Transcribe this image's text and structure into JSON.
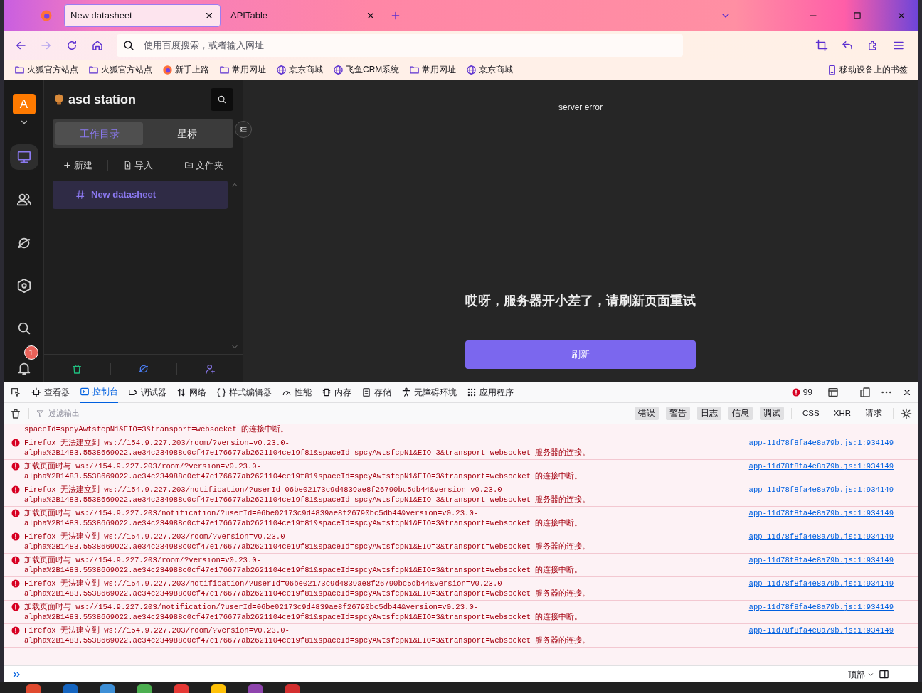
{
  "browser": {
    "tabs": [
      {
        "label": "New datasheet",
        "selected": true
      },
      {
        "label": "APITable",
        "selected": false
      }
    ],
    "address_placeholder": "使用百度搜索，或者输入网址",
    "bookmarks": [
      {
        "label": "火狐官方站点",
        "kind": "folder"
      },
      {
        "label": "火狐官方站点",
        "kind": "folder"
      },
      {
        "label": "新手上路",
        "kind": "firefox"
      },
      {
        "label": "常用网址",
        "kind": "folder"
      },
      {
        "label": "京东商城",
        "kind": "globe"
      },
      {
        "label": "飞鱼CRM系统",
        "kind": "globe"
      },
      {
        "label": "常用网址",
        "kind": "folder"
      },
      {
        "label": "京东商城",
        "kind": "globe"
      }
    ],
    "mobile_bookmarks": "移动设备上的书签"
  },
  "app": {
    "avatar": "A",
    "nav": [
      {
        "kind": "monitor",
        "selected": true
      },
      {
        "kind": "users",
        "selected": false
      },
      {
        "kind": "planet",
        "selected": false
      },
      {
        "kind": "settings",
        "selected": false
      },
      {
        "kind": "search",
        "selected": false
      },
      {
        "kind": "bell",
        "selected": false
      }
    ],
    "notification_count": "1",
    "space_name": "asd station",
    "sidebar_tabs": [
      {
        "label": "工作目录",
        "selected": true
      },
      {
        "label": "星标",
        "selected": false
      }
    ],
    "actions": [
      {
        "label": "新建",
        "kind": "plus"
      },
      {
        "label": "导入",
        "kind": "file"
      },
      {
        "label": "文件夹",
        "kind": "folderplus"
      }
    ],
    "tree": [
      {
        "label": "New datasheet",
        "selected": true
      }
    ],
    "footer": [
      {
        "kind": "trash"
      },
      {
        "kind": "planet"
      },
      {
        "kind": "personplus"
      }
    ],
    "status": "server error",
    "message": "哎呀，服务器开小差了，请刷新页面重试",
    "button": "刷新"
  },
  "devtools": {
    "tabs": [
      {
        "label": "查看器",
        "kind": "inspector",
        "selected": false
      },
      {
        "label": "控制台",
        "kind": "console",
        "selected": true
      },
      {
        "label": "调试器",
        "kind": "debugger",
        "selected": false
      },
      {
        "label": "网络",
        "kind": "network",
        "selected": false
      },
      {
        "label": "样式编辑器",
        "kind": "style",
        "selected": false
      },
      {
        "label": "性能",
        "kind": "performance",
        "selected": false
      },
      {
        "label": "内存",
        "kind": "memory",
        "selected": false
      },
      {
        "label": "存储",
        "kind": "storage",
        "selected": false
      },
      {
        "label": "无障碍环境",
        "kind": "accessibility",
        "selected": false
      },
      {
        "label": "应用程序",
        "kind": "application",
        "selected": false
      }
    ],
    "error_count": "99+",
    "filter_placeholder": "过滤输出",
    "filters": [
      {
        "label": "错误",
        "on": true
      },
      {
        "label": "警告",
        "on": true
      },
      {
        "label": "日志",
        "on": true
      },
      {
        "label": "信息",
        "on": true
      },
      {
        "label": "调试",
        "on": true
      },
      {
        "label": "CSS",
        "on": false
      },
      {
        "label": "XHR",
        "on": false
      },
      {
        "label": "请求",
        "on": false
      }
    ],
    "logs": [
      {
        "kind": "continuation",
        "message": "spaceId=spcyAwtsfcpN1&EIO=3&transport=websocket 的连接中断。"
      },
      {
        "kind": "error",
        "message": "Firefox 无法建立到 ws://154.9.227.203/room/?version=v0.23.0-alpha%2B1483.5538669022.ae34c234988c0cf47e176677ab2621104ce19f81&spaceId=spcyAwtsfcpN1&EIO=3&transport=websocket 服务器的连接。",
        "source": "app-11d78f8fa4e8a79b.js:1:934149"
      },
      {
        "kind": "error",
        "message": "加载页面时与 ws://154.9.227.203/room/?version=v0.23.0-alpha%2B1483.5538669022.ae34c234988c0cf47e176677ab2621104ce19f81&spaceId=spcyAwtsfcpN1&EIO=3&transport=websocket 的连接中断。",
        "source": "app-11d78f8fa4e8a79b.js:1:934149"
      },
      {
        "kind": "error",
        "message": "Firefox 无法建立到 ws://154.9.227.203/notification/?userId=06be02173c9d4839ae8f26790bc5db44&version=v0.23.0-alpha%2B1483.5538669022.ae34c234988c0cf47e176677ab2621104ce19f81&spaceId=spcyAwtsfcpN1&EIO=3&transport=websocket 服务器的连接。",
        "source": "app-11d78f8fa4e8a79b.js:1:934149"
      },
      {
        "kind": "error",
        "message": "加载页面时与 ws://154.9.227.203/notification/?userId=06be02173c9d4839ae8f26790bc5db44&version=v0.23.0-alpha%2B1483.5538669022.ae34c234988c0cf47e176677ab2621104ce19f81&spaceId=spcyAwtsfcpN1&EIO=3&transport=websocket 的连接中断。",
        "source": "app-11d78f8fa4e8a79b.js:1:934149"
      },
      {
        "kind": "error",
        "message": "Firefox 无法建立到 ws://154.9.227.203/room/?version=v0.23.0-alpha%2B1483.5538669022.ae34c234988c0cf47e176677ab2621104ce19f81&spaceId=spcyAwtsfcpN1&EIO=3&transport=websocket 服务器的连接。",
        "source": "app-11d78f8fa4e8a79b.js:1:934149"
      },
      {
        "kind": "error",
        "message": "加载页面时与 ws://154.9.227.203/room/?version=v0.23.0-alpha%2B1483.5538669022.ae34c234988c0cf47e176677ab2621104ce19f81&spaceId=spcyAwtsfcpN1&EIO=3&transport=websocket 的连接中断。",
        "source": "app-11d78f8fa4e8a79b.js:1:934149"
      },
      {
        "kind": "error",
        "message": "Firefox 无法建立到 ws://154.9.227.203/notification/?userId=06be02173c9d4839ae8f26790bc5db44&version=v0.23.0-alpha%2B1483.5538669022.ae34c234988c0cf47e176677ab2621104ce19f81&spaceId=spcyAwtsfcpN1&EIO=3&transport=websocket 服务器的连接。",
        "source": "app-11d78f8fa4e8a79b.js:1:934149"
      },
      {
        "kind": "error",
        "message": "加载页面时与 ws://154.9.227.203/notification/?userId=06be02173c9d4839ae8f26790bc5db44&version=v0.23.0-alpha%2B1483.5538669022.ae34c234988c0cf47e176677ab2621104ce19f81&spaceId=spcyAwtsfcpN1&EIO=3&transport=websocket 的连接中断。",
        "source": "app-11d78f8fa4e8a79b.js:1:934149"
      },
      {
        "kind": "error",
        "message": "Firefox 无法建立到 ws://154.9.227.203/room/?version=v0.23.0-alpha%2B1483.5538669022.ae34c234988c0cf47e176677ab2621104ce19f81&spaceId=spcyAwtsfcpN1&EIO=3&transport=websocket 服务器的连接。",
        "source": "app-11d78f8fa4e8a79b.js:1:934149"
      }
    ],
    "scope": "顶部"
  }
}
